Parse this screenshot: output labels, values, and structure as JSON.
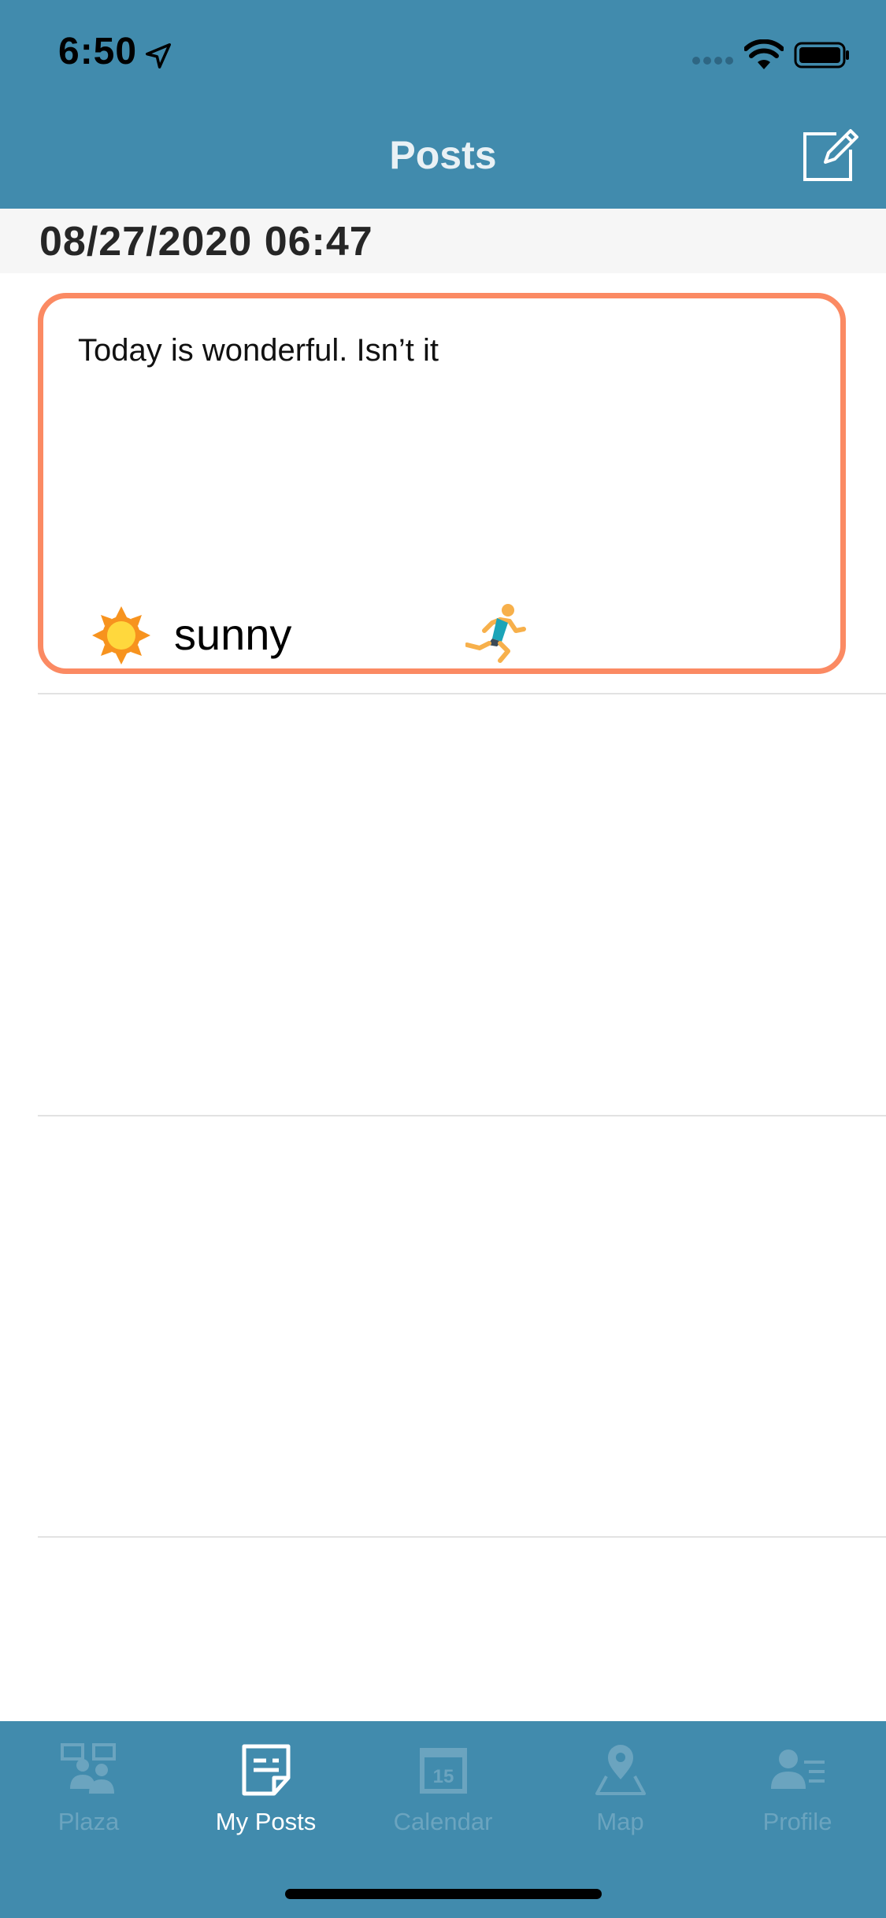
{
  "status_bar": {
    "time": "6:50"
  },
  "nav": {
    "title": "Posts"
  },
  "section": {
    "date": "08/27/2020 06:47"
  },
  "post": {
    "text": "Today is wonderful. Isn’t it",
    "weather_label": "sunny",
    "weather_icon": "sun-icon",
    "activity_icon": "runner-icon"
  },
  "tabs": [
    {
      "label": "Plaza",
      "icon": "plaza-icon",
      "active": false
    },
    {
      "label": "My Posts",
      "icon": "posts-icon",
      "active": true
    },
    {
      "label": "Calendar",
      "icon": "calendar-icon",
      "active": false
    },
    {
      "label": "Map",
      "icon": "map-pin-icon",
      "active": false
    },
    {
      "label": "Profile",
      "icon": "profile-icon",
      "active": false
    }
  ],
  "colors": {
    "header": "#418bad",
    "card_border": "#fb8a63",
    "tab_inactive": "#6ba4bf",
    "tab_active": "#ffffff"
  }
}
